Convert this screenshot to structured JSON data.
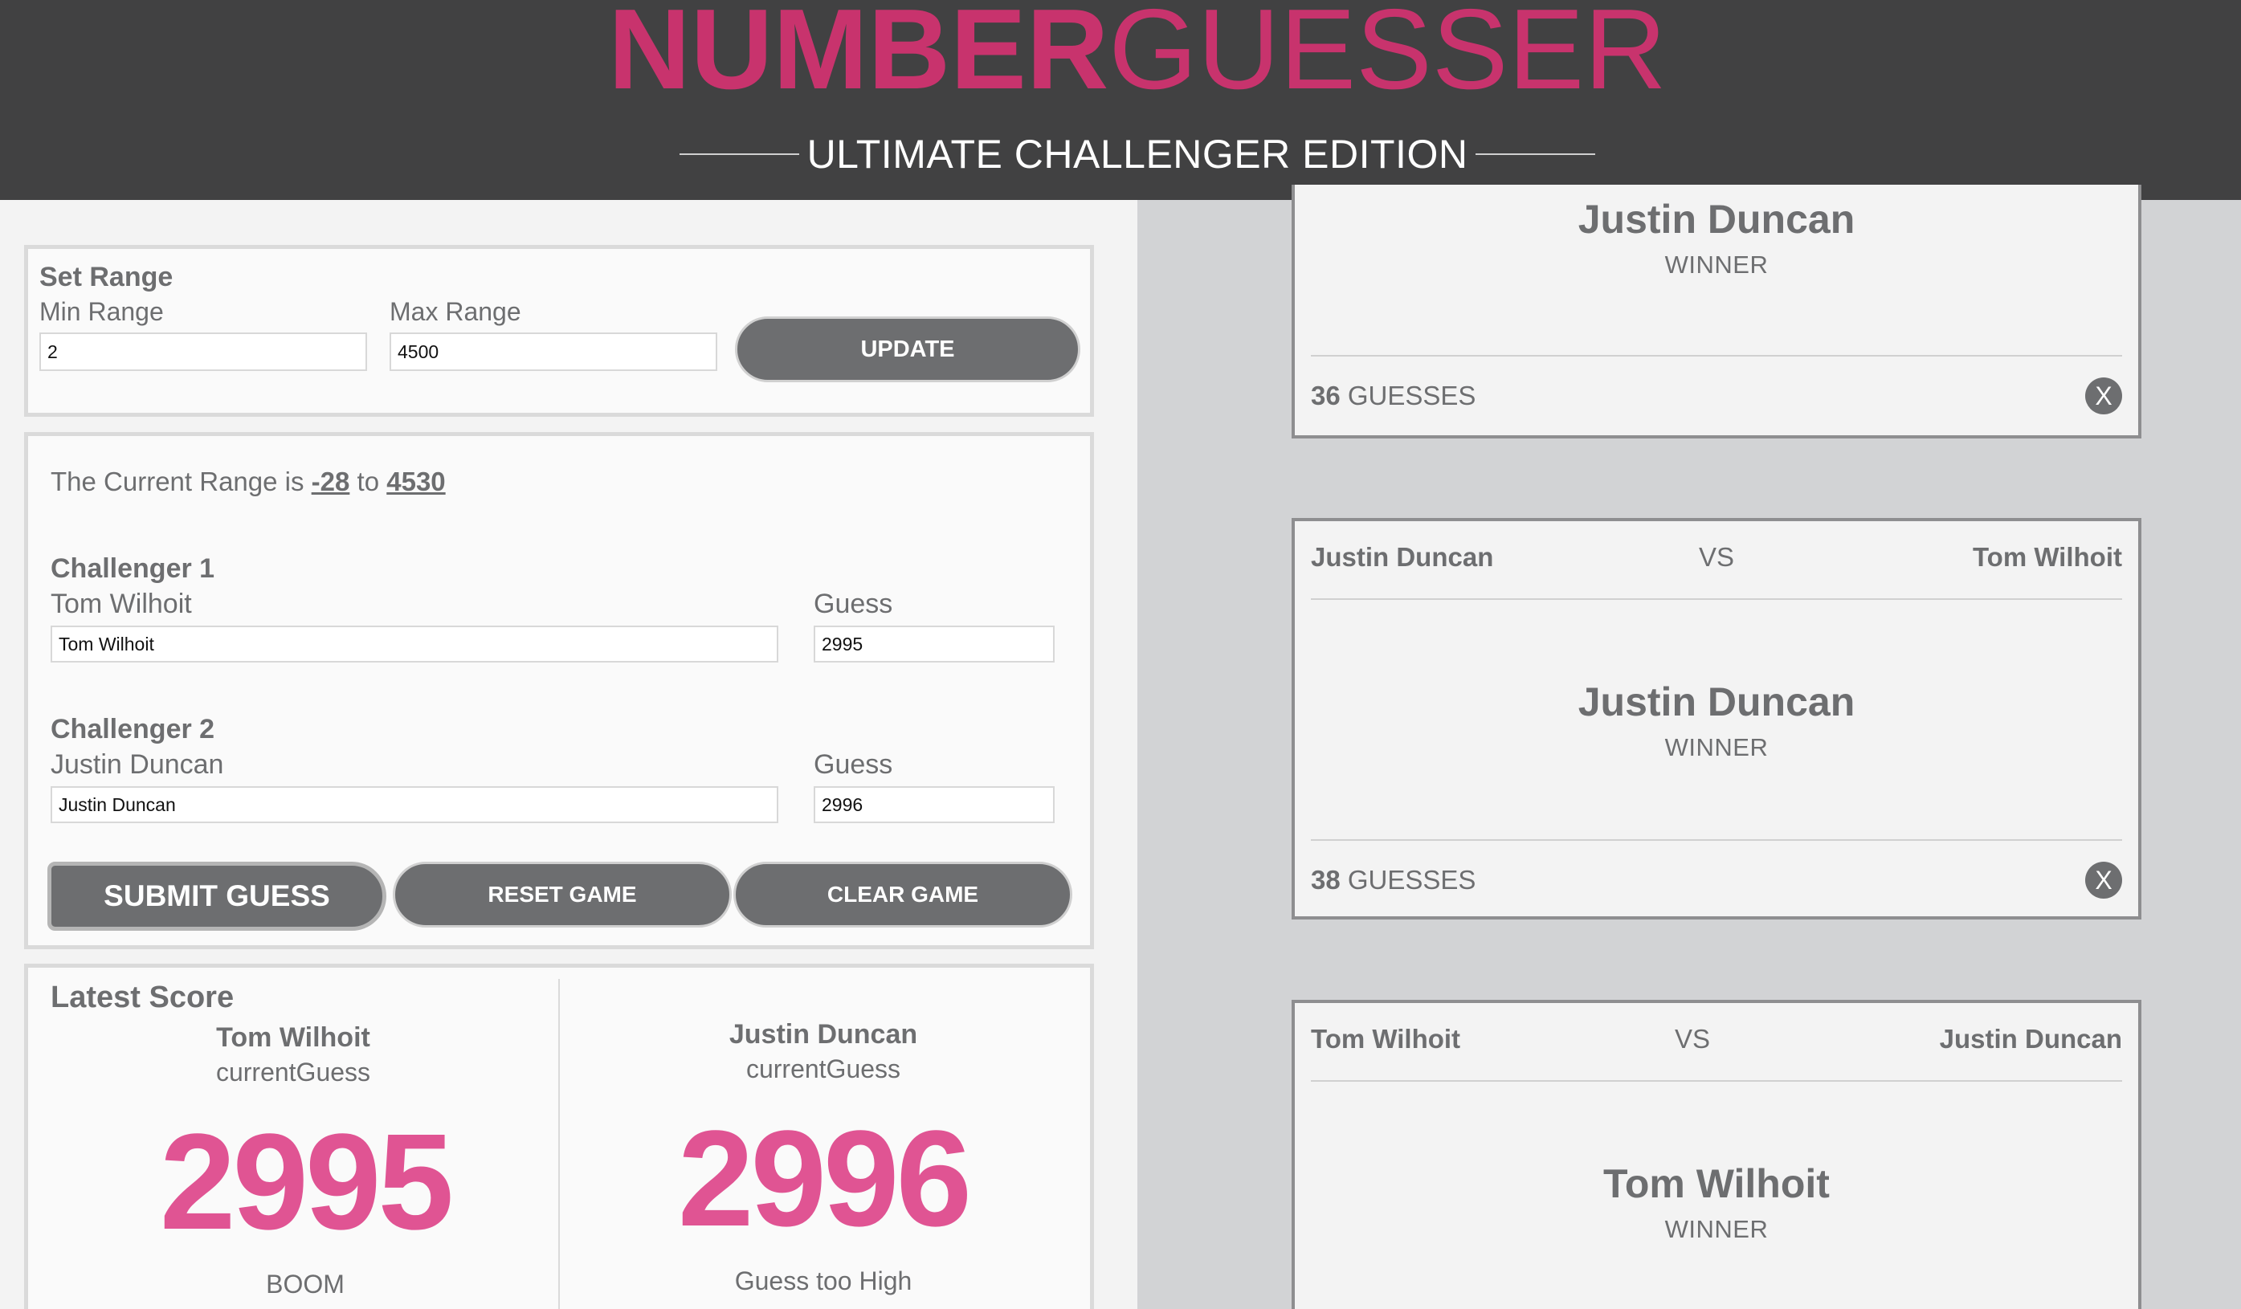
{
  "header": {
    "title_bold": "NUMBER",
    "title_light": "GUESSER",
    "subtitle": "ULTIMATE CHALLENGER EDITION"
  },
  "set_range": {
    "heading": "Set Range",
    "min_label": "Min Range",
    "min_value": "2",
    "max_label": "Max Range",
    "max_value": "4500",
    "update_button": "UPDATE"
  },
  "current_range": {
    "prefix": "The Current Range is",
    "min": "-28",
    "joiner": "to",
    "max": "4530"
  },
  "challengers": [
    {
      "heading": "Challenger 1",
      "name_label": "Tom Wilhoit",
      "name_value": "Tom Wilhoit",
      "guess_label": "Guess",
      "guess_value": "2995"
    },
    {
      "heading": "Challenger 2",
      "name_label": "Justin Duncan",
      "name_value": "Justin Duncan",
      "guess_label": "Guess",
      "guess_value": "2996"
    }
  ],
  "buttons": {
    "submit": "SUBMIT GUESS",
    "reset": "RESET GAME",
    "clear": "CLEAR GAME"
  },
  "latest_score": {
    "heading": "Latest Score",
    "players": [
      {
        "name": "Tom Wilhoit",
        "sub": "currentGuess",
        "guess": "2995",
        "status": "BOOM"
      },
      {
        "name": "Justin Duncan",
        "sub": "currentGuess",
        "guess": "2996",
        "status": "Guess too High"
      }
    ]
  },
  "cards": [
    {
      "winner_name": "Justin Duncan",
      "winner_label": "WINNER",
      "guesses_count": "36",
      "guesses_label": "GUESSES",
      "close": "X"
    },
    {
      "left": "Justin Duncan",
      "vs": "VS",
      "right": "Tom Wilhoit",
      "winner_name": "Justin Duncan",
      "winner_label": "WINNER",
      "guesses_count": "38",
      "guesses_label": "GUESSES",
      "close": "X"
    },
    {
      "left": "Tom Wilhoit",
      "vs": "VS",
      "right": "Justin Duncan",
      "winner_name": "Tom Wilhoit",
      "winner_label": "WINNER"
    }
  ],
  "colors": {
    "header_bg": "#414142",
    "accent_pink": "#c8336d",
    "score_pink": "#e05493",
    "button_gray": "#6d6e70"
  }
}
